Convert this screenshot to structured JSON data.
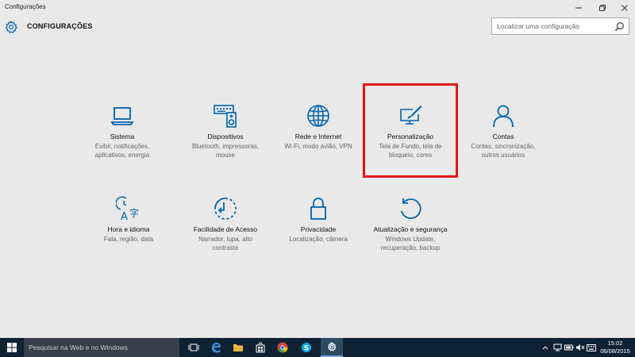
{
  "window": {
    "title": "Configurações"
  },
  "header": {
    "title": "CONFIGURAÇÕES",
    "search_placeholder": "Localizar uma configuração"
  },
  "tiles": [
    {
      "id": "sistema",
      "icon": "laptop-icon",
      "label": "Sistema",
      "desc1": "Exibir, notificações,",
      "desc2": "aplicativos, energia",
      "desc3": ""
    },
    {
      "id": "dispositivos",
      "icon": "keyboard-speaker-icon",
      "label": "Dispositivos",
      "desc1": "Bluetooth, impressoras,",
      "desc2": "mouse",
      "desc3": ""
    },
    {
      "id": "rede",
      "icon": "globe-icon",
      "label": "Rede e Internet",
      "desc1": "Wi-Fi, modo avião, VPN",
      "desc2": "",
      "desc3": ""
    },
    {
      "id": "personalizacao",
      "icon": "paint-brush-monitor-icon",
      "label": "Personalização",
      "desc1": "Tela de Fundo, tela de",
      "desc2": "bloqueio, cores",
      "desc3": ""
    },
    {
      "id": "contas",
      "icon": "person-icon",
      "label": "Contas",
      "desc1": "Contas, sincronização,",
      "desc2": "outros usuários",
      "desc3": ""
    },
    {
      "id": "hora",
      "icon": "time-language-icon",
      "label": "Hora e idioma",
      "desc1": "Fala, região, data",
      "desc2": "",
      "desc3": ""
    },
    {
      "id": "acesso",
      "icon": "ease-of-access-icon",
      "label": "Facilidade de Acesso",
      "desc1": "Narrador, lupa, alto",
      "desc2": "contraste",
      "desc3": ""
    },
    {
      "id": "privacidade",
      "icon": "lock-icon",
      "label": "Privacidade",
      "desc1": "Localização, câmera",
      "desc2": "",
      "desc3": ""
    },
    {
      "id": "atualizacao",
      "icon": "refresh-icon",
      "label": "Atualização e segurança",
      "desc1": "Windows Update,",
      "desc2": "recuperação, backup",
      "desc3": ""
    }
  ],
  "taskbar": {
    "search_placeholder": "Pesquisar na Web e no Windows",
    "time": "15:02",
    "date": "06/08/2015"
  },
  "colors": {
    "accent": "#0063b1",
    "background": "#e9e9e9",
    "highlight": "#e3151c",
    "taskbar": "#0f2234"
  }
}
